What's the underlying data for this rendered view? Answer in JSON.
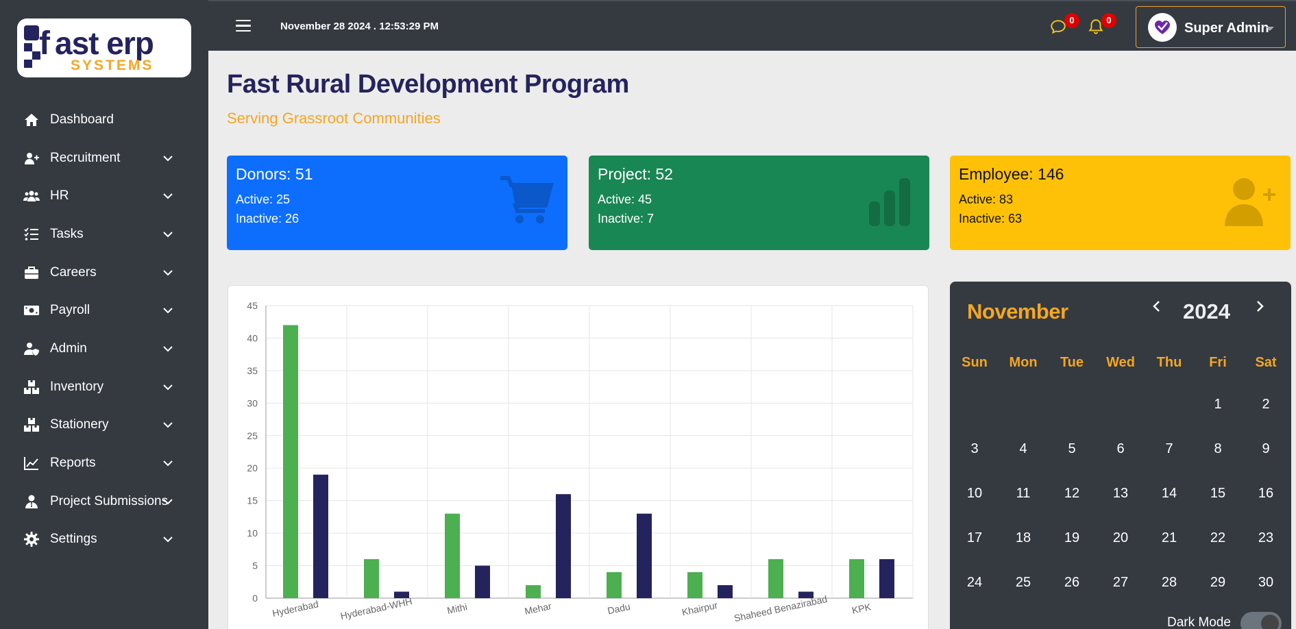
{
  "brand": {
    "logo_text_main": "ast erp",
    "logo_text_sub": "SYSTEMS",
    "logo_f": "f"
  },
  "sidebar": {
    "items": [
      {
        "label": "Dashboard",
        "icon": "home-icon",
        "has_submenu": false
      },
      {
        "label": "Recruitment",
        "icon": "user-plus-icon",
        "has_submenu": true
      },
      {
        "label": "HR",
        "icon": "users-icon",
        "has_submenu": true
      },
      {
        "label": "Tasks",
        "icon": "tasks-icon",
        "has_submenu": true
      },
      {
        "label": "Careers",
        "icon": "briefcase-icon",
        "has_submenu": true
      },
      {
        "label": "Payroll",
        "icon": "money-icon",
        "has_submenu": true
      },
      {
        "label": "Admin",
        "icon": "user-shield-icon",
        "has_submenu": true
      },
      {
        "label": "Inventory",
        "icon": "boxes-icon",
        "has_submenu": true
      },
      {
        "label": "Stationery",
        "icon": "boxes-icon",
        "has_submenu": true
      },
      {
        "label": "Reports",
        "icon": "line-chart-icon",
        "has_submenu": true
      },
      {
        "label": "Project Submissions",
        "icon": "user-tie-icon",
        "has_submenu": true
      },
      {
        "label": "Settings",
        "icon": "gear-icon",
        "has_submenu": true
      }
    ]
  },
  "topbar": {
    "datetime": "November 28 2024 . 12:53:29 PM",
    "messages_count": "0",
    "notifications_count": "0",
    "user_name": "Super Admin"
  },
  "header": {
    "title": "Fast Rural Development Program",
    "subtitle": "Serving Grassroot Communities"
  },
  "cards": [
    {
      "title": "Donors: 51",
      "active": "Active: 25",
      "inactive": "Inactive: 26",
      "color": "#0d6efd",
      "icon": "cart-icon"
    },
    {
      "title": "Project: 52",
      "active": "Active: 45",
      "inactive": "Inactive: 7",
      "color": "#198754",
      "icon": "bar-chart-icon"
    },
    {
      "title": "Employee: 146",
      "active": "Active: 83",
      "inactive": "Inactive: 63",
      "color": "#ffc107",
      "icon": "user-plus-icon"
    }
  ],
  "chart_data": {
    "type": "bar",
    "categories": [
      "Hyderabad",
      "Hyderabad-WHH",
      "Mithi",
      "Mehar",
      "Dadu",
      "Khairpur",
      "Shaheed Benazirabad",
      "KPK"
    ],
    "series": [
      {
        "values": [
          42,
          6,
          13,
          2,
          4,
          4,
          6,
          6
        ],
        "color": "#4caf50"
      },
      {
        "values": [
          19,
          1,
          5,
          16,
          13,
          2,
          1,
          6
        ],
        "color": "#25235e"
      }
    ],
    "ylim": [
      0,
      45
    ],
    "yticks": [
      0,
      5,
      10,
      15,
      20,
      25,
      30,
      35,
      40,
      45
    ],
    "grid": true
  },
  "calendar": {
    "month": "November",
    "year": "2024",
    "weekdays": [
      "Sun",
      "Mon",
      "Tue",
      "Wed",
      "Thu",
      "Fri",
      "Sat"
    ],
    "weeks": [
      [
        "",
        "",
        "",
        "",
        "",
        "1",
        "2"
      ],
      [
        "3",
        "4",
        "5",
        "6",
        "7",
        "8",
        "9"
      ],
      [
        "10",
        "11",
        "12",
        "13",
        "14",
        "15",
        "16"
      ],
      [
        "17",
        "18",
        "19",
        "20",
        "21",
        "22",
        "23"
      ],
      [
        "24",
        "25",
        "26",
        "27",
        "28",
        "29",
        "30"
      ]
    ],
    "dark_mode_label": "Dark Mode"
  },
  "colors": {
    "accent": "#f5a623",
    "title": "#25235e",
    "sidebar": "#343a40"
  }
}
